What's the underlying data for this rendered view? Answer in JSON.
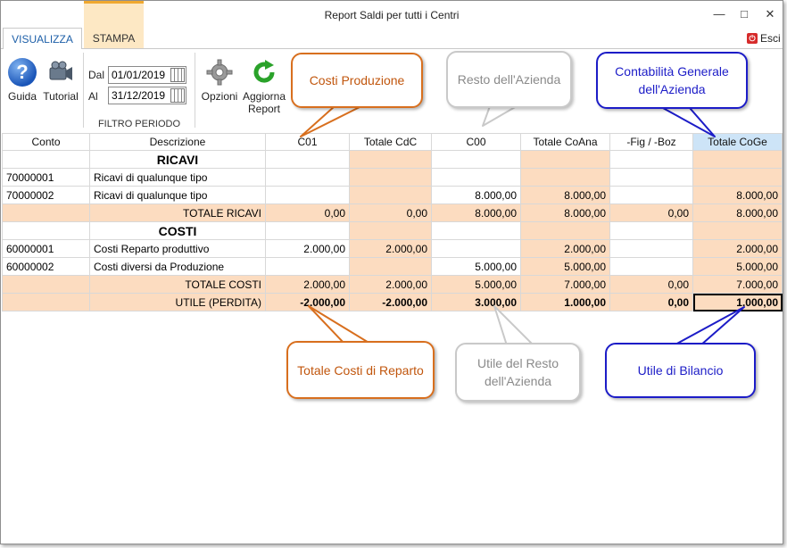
{
  "window": {
    "title": "Report Saldi per tutti i Centri"
  },
  "tabs": [
    {
      "label": "VISUALIZZA"
    },
    {
      "label": "STAMPA"
    }
  ],
  "esci": {
    "label": "Esci"
  },
  "ribbon": {
    "guida": "Guida",
    "tutorial": "Tutorial",
    "opzioni": "Opzioni",
    "aggiorna": "Aggiorna Report",
    "filtro": {
      "dal_label": "Dal",
      "al_label": "Al",
      "dal_value": "01/01/2019",
      "al_value": "31/12/2019",
      "group_label": "FILTRO PERIODO"
    }
  },
  "table": {
    "columns": [
      "Conto",
      "Descrizione",
      "C01",
      "Totale CdC",
      "C00",
      "Totale CoAna",
      "-Fig / -Boz",
      "Totale CoGe"
    ],
    "rows": [
      {
        "type": "section",
        "cells": [
          "",
          "RICAVI",
          "",
          "",
          "",
          "",
          "",
          ""
        ]
      },
      {
        "type": "data",
        "cells": [
          "70000001",
          "Ricavi di qualunque tipo",
          "",
          "",
          "",
          "",
          "",
          ""
        ]
      },
      {
        "type": "data",
        "cells": [
          "70000002",
          "Ricavi di qualunque tipo",
          "",
          "",
          "8.000,00",
          "8.000,00",
          "",
          "8.000,00"
        ]
      },
      {
        "type": "total",
        "cells": [
          "",
          "TOTALE RICAVI",
          "0,00",
          "0,00",
          "8.000,00",
          "8.000,00",
          "0,00",
          "8.000,00"
        ]
      },
      {
        "type": "section",
        "cells": [
          "",
          "COSTI",
          "",
          "",
          "",
          "",
          "",
          ""
        ]
      },
      {
        "type": "data",
        "cells": [
          "60000001",
          "Costi Reparto produttivo",
          "2.000,00",
          "2.000,00",
          "",
          "2.000,00",
          "",
          "2.000,00"
        ]
      },
      {
        "type": "data",
        "cells": [
          "60000002",
          "Costi diversi da Produzione",
          "",
          "",
          "5.000,00",
          "5.000,00",
          "",
          "5.000,00"
        ]
      },
      {
        "type": "total",
        "cells": [
          "",
          "TOTALE COSTI",
          "2.000,00",
          "2.000,00",
          "5.000,00",
          "7.000,00",
          "0,00",
          "7.000,00"
        ]
      },
      {
        "type": "total-bold",
        "cells": [
          "",
          "UTILE (PERDITA)",
          "-2.000,00",
          "-2.000,00",
          "3.000,00",
          "1.000,00",
          "0,00",
          "1.000,00"
        ]
      }
    ]
  },
  "callouts": {
    "costi_produzione": "Costi Produzione",
    "resto_azienda": "Resto dell'Azienda",
    "contabilita_generale": "Contabilità Generale dell'Azienda",
    "totale_costi_reparto": "Totale Costi di Reparto",
    "utile_resto": "Utile del Resto dell'Azienda",
    "utile_bilancio": "Utile di Bilancio"
  },
  "colors": {
    "peach": "#fcdcc0",
    "header_active": "#cde4f7",
    "callout_orange": "#d86f1e",
    "callout_gray": "#c9c9c9",
    "callout_blue": "#1c1cc7",
    "tab_accent": "#f0a830"
  }
}
